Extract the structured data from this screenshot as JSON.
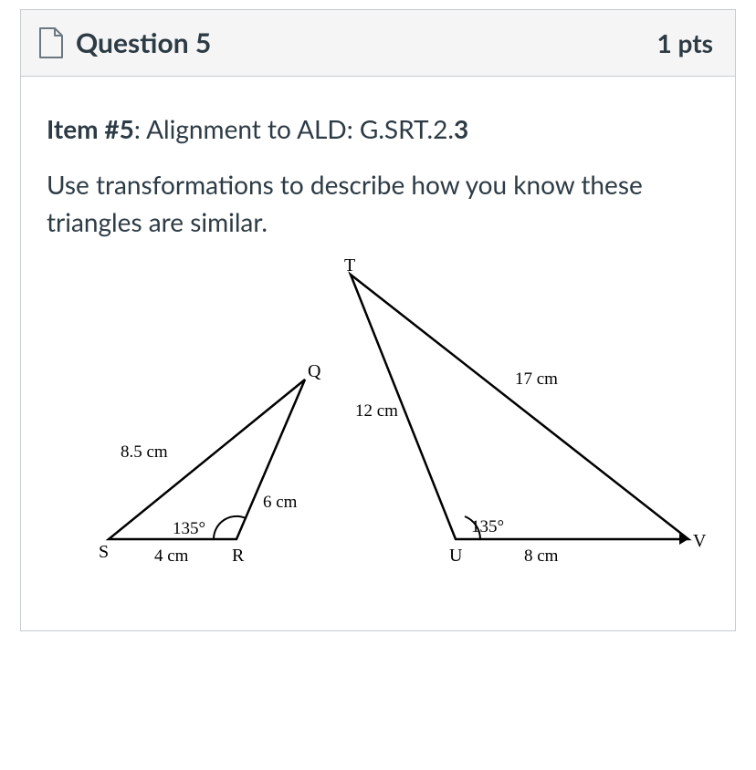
{
  "header": {
    "title": "Question 5",
    "points": "1 pts"
  },
  "body": {
    "item_label": "Item #5",
    "item_rest": ": Alignment to ALD: G.SRT.2.",
    "item_tail_bold": "3",
    "prompt": "Use transformations to describe how you know these triangles are similar."
  },
  "figure": {
    "tri1": {
      "S": "S",
      "R": "R",
      "Q": "Q",
      "SQ_len": "8.5 cm",
      "SR_len": "4 cm",
      "RQ_len": "6 cm",
      "angle": "135°"
    },
    "tri2": {
      "T": "T",
      "U": "U",
      "V": "V",
      "TU_len": "12 cm",
      "UV_len": "8 cm",
      "TV_len": "17 cm",
      "angle": "135°"
    }
  }
}
